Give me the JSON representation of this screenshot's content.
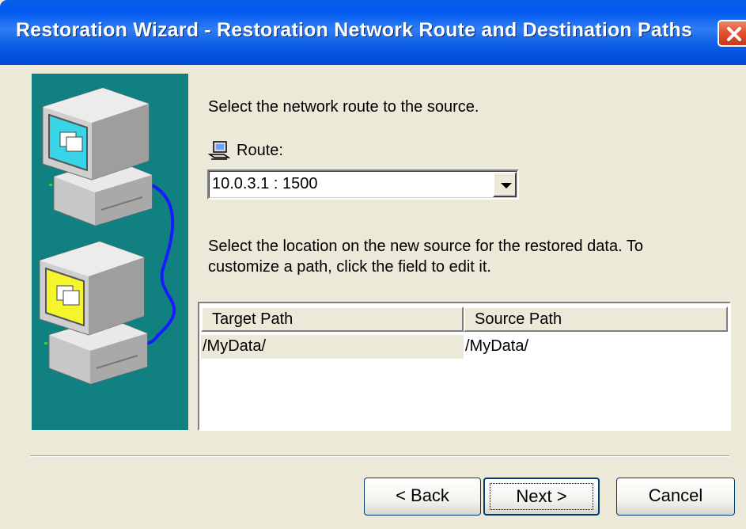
{
  "window": {
    "title": "Restoration Wizard - Restoration Network Route and Destination Paths"
  },
  "content": {
    "route_instruction": "Select the network route to the source.",
    "route_label": "Route:",
    "route_value": "10.0.3.1 : 1500",
    "location_instruction_line1": "Select the location on the new source for the restored data. To",
    "location_instruction_line2": "customize a path, click the field to edit it."
  },
  "paths_table": {
    "columns": [
      "Target Path",
      "Source Path"
    ],
    "rows": [
      [
        "/MyData/",
        "/MyData/"
      ]
    ]
  },
  "buttons": {
    "back": "< Back",
    "next": "Next >",
    "cancel": "Cancel"
  },
  "icons": {
    "close": "close-icon",
    "route": "network-computer-icon",
    "dropdown": "chevron-down-icon",
    "illustration": "network-computers-illustration"
  },
  "colors": {
    "title_bar": "#0058ee",
    "side_panel": "#108080",
    "dialog_bg": "#ece9d8",
    "close_button": "#e0502c"
  }
}
